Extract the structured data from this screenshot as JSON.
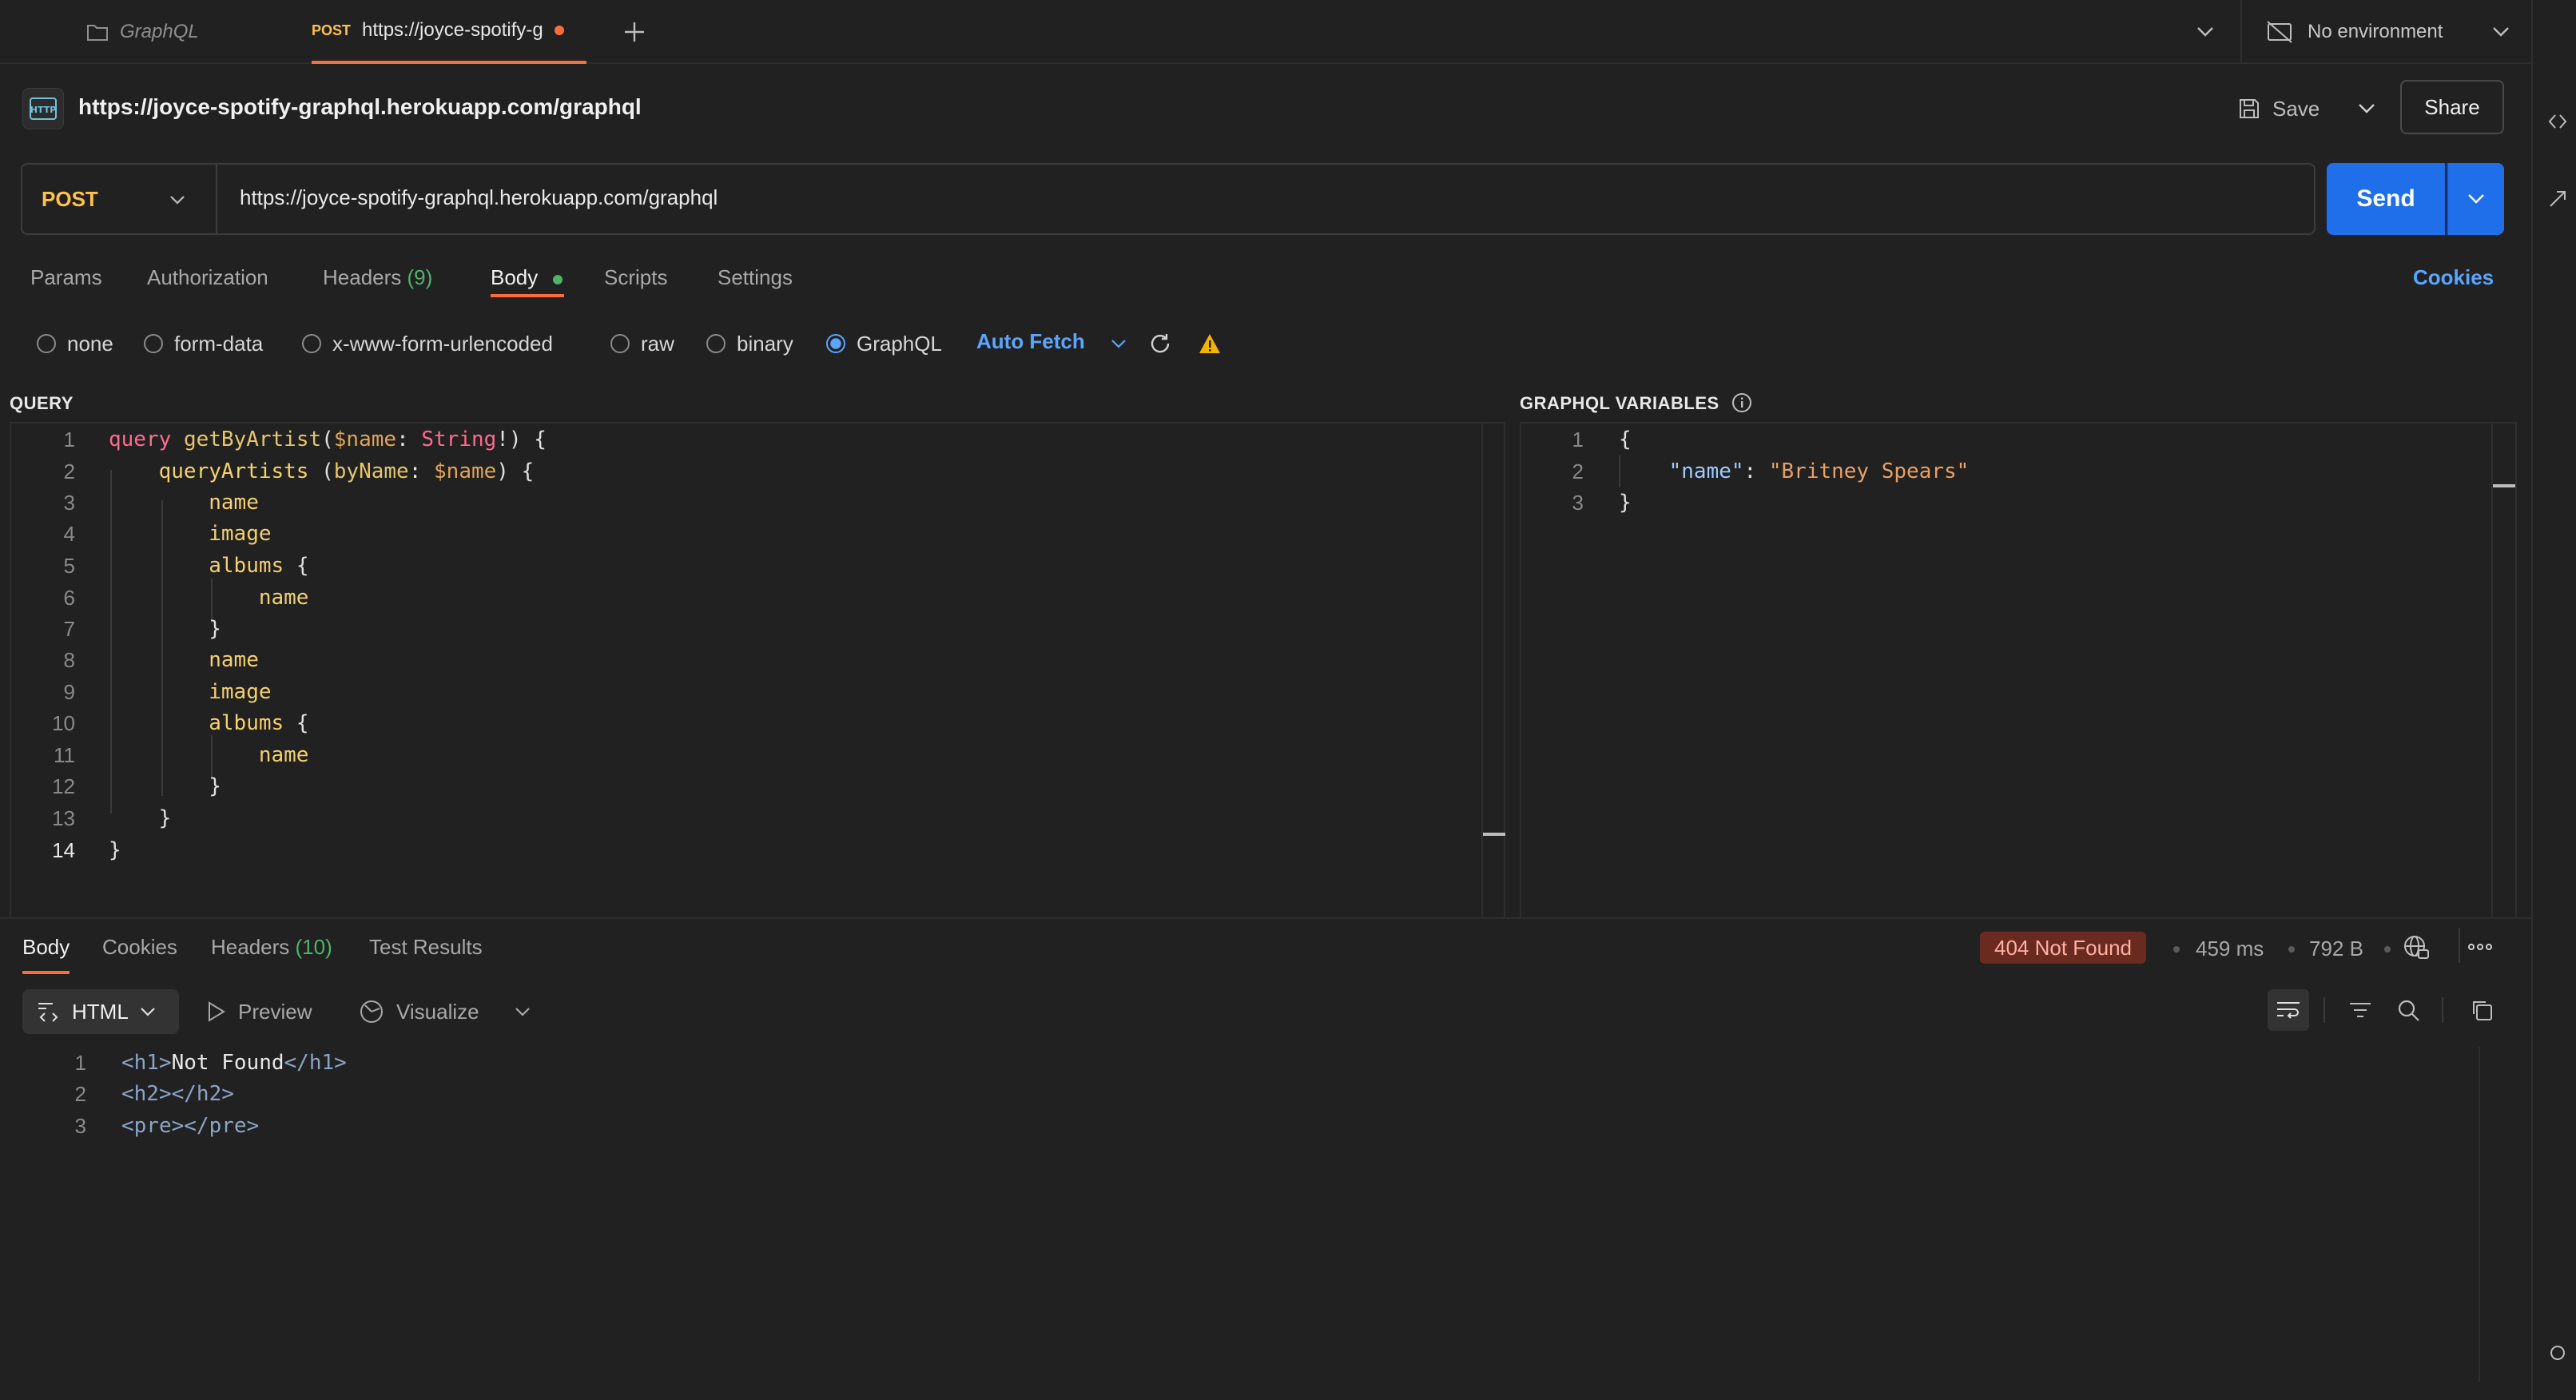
{
  "tabs": {
    "folder_tab": "GraphQL",
    "active_method": "POST",
    "active_title": "https://joyce-spotify-g",
    "environment": "No environment"
  },
  "request": {
    "title": "https://joyce-spotify-graphql.herokuapp.com/graphql",
    "save_label": "Save",
    "share_label": "Share",
    "method": "POST",
    "url": "https://joyce-spotify-graphql.herokuapp.com/graphql",
    "send_label": "Send"
  },
  "request_tabs": [
    {
      "label": "Params"
    },
    {
      "label": "Authorization"
    },
    {
      "label": "Headers",
      "count": "(9)"
    },
    {
      "label": "Body"
    },
    {
      "label": "Scripts"
    },
    {
      "label": "Settings"
    }
  ],
  "cookies_label": "Cookies",
  "body_types": [
    "none",
    "form-data",
    "x-www-form-urlencoded",
    "raw",
    "binary",
    "GraphQL"
  ],
  "body_type_selected": "GraphQL",
  "auto_fetch_label": "Auto Fetch",
  "query": {
    "label": "QUERY",
    "line_numbers": [
      "1",
      "2",
      "3",
      "4",
      "5",
      "6",
      "7",
      "8",
      "9",
      "10",
      "11",
      "12",
      "13",
      "14"
    ],
    "lines": [
      "query getByArtist($name: String!) {",
      "    queryArtists (byName: $name) {",
      "        name",
      "        image",
      "        albums {",
      "            name",
      "        }",
      "        name",
      "        image",
      "        albums {",
      "            name",
      "        }",
      "    }",
      "}"
    ]
  },
  "variables": {
    "label": "GRAPHQL VARIABLES",
    "line_numbers": [
      "1",
      "2",
      "3"
    ],
    "lines": [
      "{",
      "    \"name\": \"Britney Spears\"",
      "}"
    ]
  },
  "response": {
    "tabs": [
      {
        "label": "Body"
      },
      {
        "label": "Cookies"
      },
      {
        "label": "Headers",
        "count": "(10)"
      },
      {
        "label": "Test Results"
      }
    ],
    "status": "404 Not Found",
    "time": "459 ms",
    "size": "792 B",
    "format": "HTML",
    "preview_label": "Preview",
    "visualize_label": "Visualize",
    "line_numbers": [
      "1",
      "2",
      "3"
    ],
    "lines": [
      "<h1>Not Found</h1>",
      "<h2></h2>",
      "<pre></pre>"
    ]
  },
  "colors": {
    "background": "#212121",
    "accent_orange": "#ff6c37",
    "send_blue": "#1f6feb",
    "link_blue": "#5aa5ff",
    "method_yellow": "#ffc24b",
    "status_error_bg": "#6b2a20"
  }
}
